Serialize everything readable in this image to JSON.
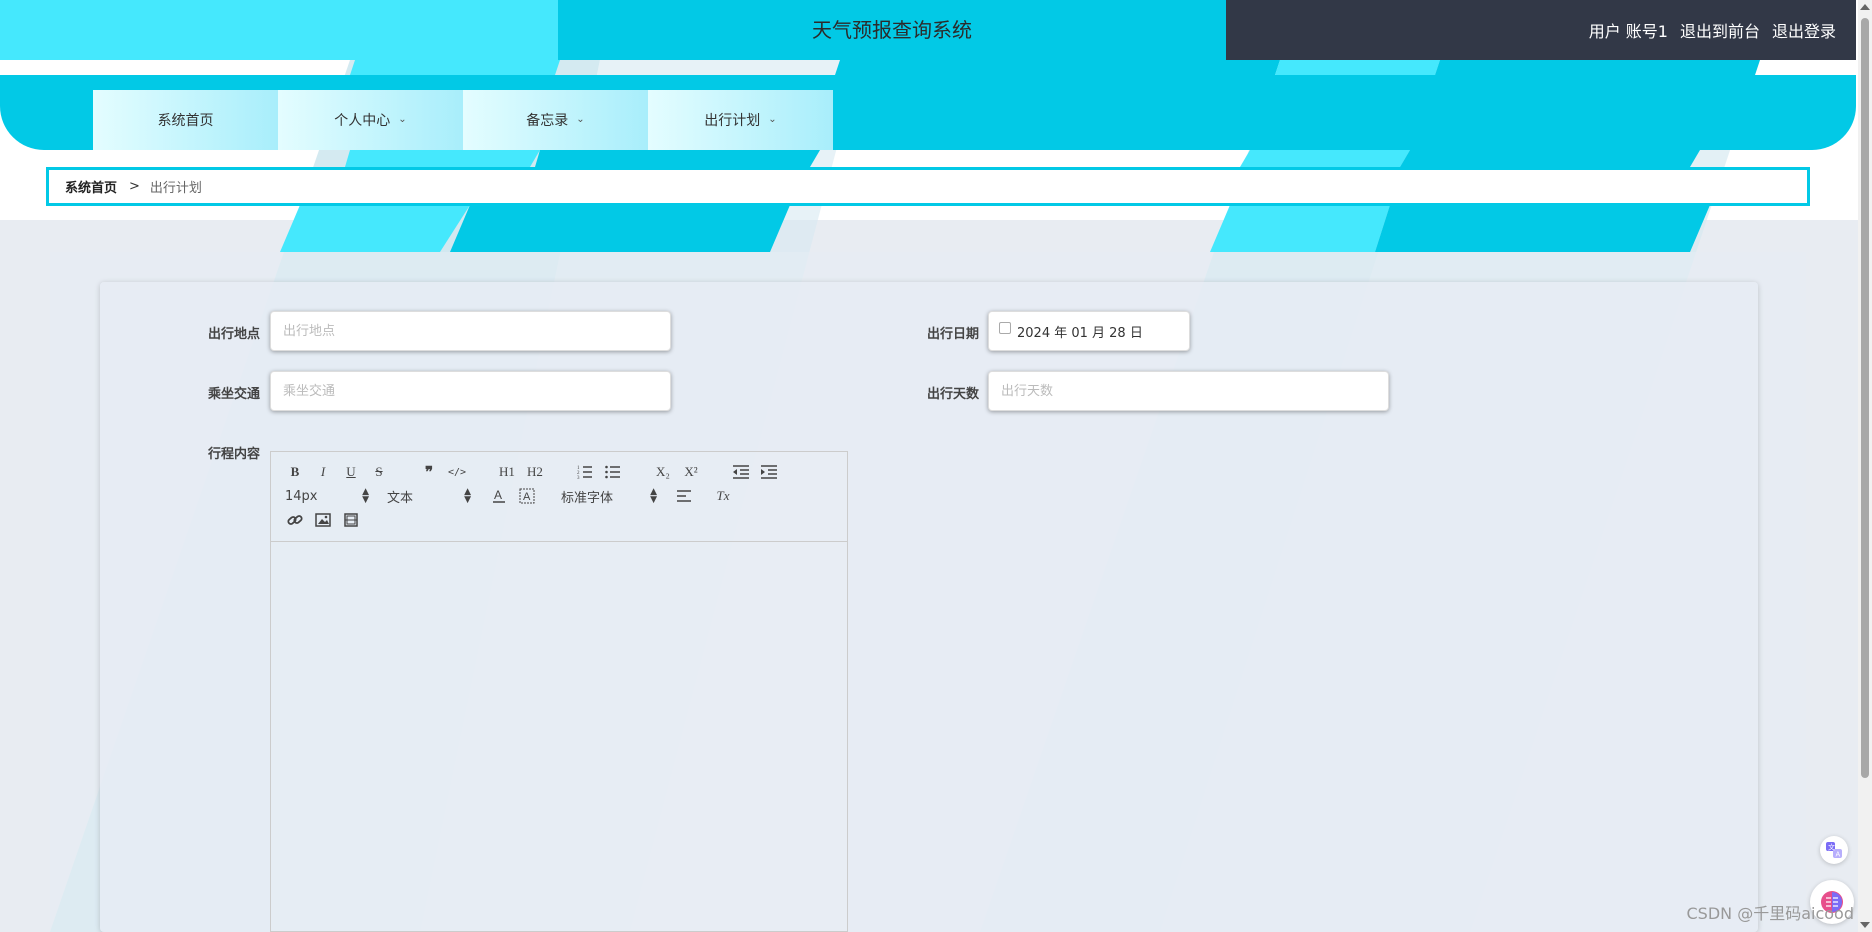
{
  "header": {
    "title": "天气预报查询系统",
    "user_label": "用户 账号1",
    "to_front": "退出到前台",
    "logout": "退出登录"
  },
  "nav": {
    "items": [
      {
        "label": "系统首页"
      },
      {
        "label": "个人中心"
      },
      {
        "label": "备忘录"
      },
      {
        "label": "出行计划"
      }
    ]
  },
  "breadcrumb": {
    "home": "系统首页",
    "separator": ">",
    "current": "出行计划"
  },
  "form": {
    "location": {
      "label": "出行地点",
      "placeholder": "出行地点",
      "value": ""
    },
    "date": {
      "label": "出行日期",
      "value": "2024 年 01 月 28 日"
    },
    "transport": {
      "label": "乘坐交通",
      "placeholder": "乘坐交通",
      "value": ""
    },
    "days": {
      "label": "出行天数",
      "placeholder": "出行天数",
      "value": ""
    },
    "content": {
      "label": "行程内容"
    }
  },
  "editor": {
    "font_size": "14px",
    "header_select": "文本",
    "font_family": "标准字体",
    "buttons": {
      "bold": "B",
      "italic": "I",
      "underline": "U",
      "strike": "S",
      "blockquote": "❞",
      "code": "</>",
      "h1": "H1",
      "h2": "H2",
      "subscript": "X₂",
      "superscript": "X²",
      "clean": "Tx"
    }
  },
  "watermark": "CSDN @千里码aicood",
  "colors": {
    "accent": "#02c9e6",
    "accent_light": "#45e8fd",
    "header_dark": "#323847",
    "page_bg": "#e8ecf2"
  }
}
